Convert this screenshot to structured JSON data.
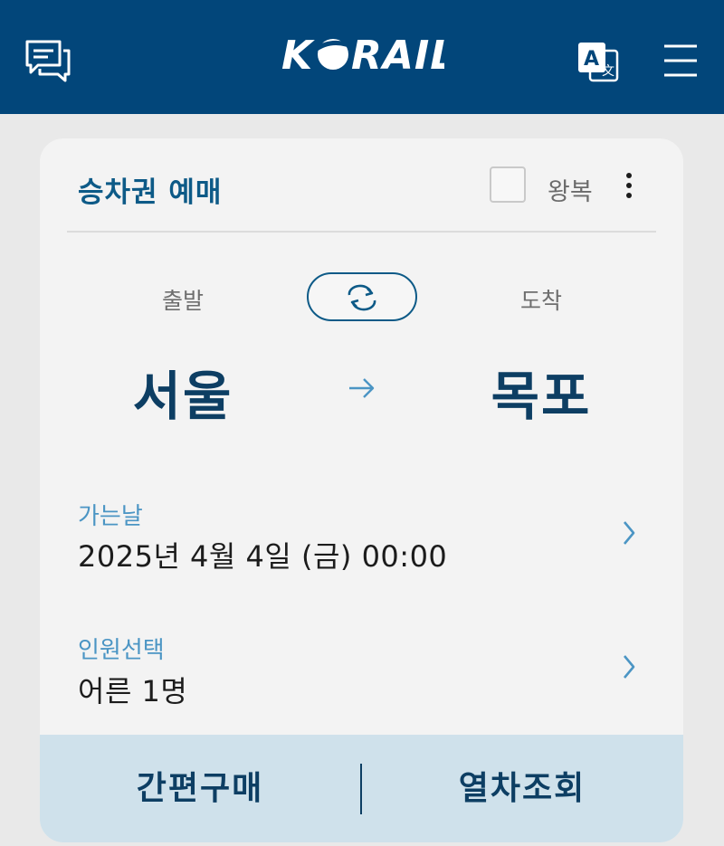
{
  "header": {
    "logo_text": "KORAIL",
    "chat_icon": "chat-icon",
    "translate_icon": "translate-icon",
    "menu_icon": "menu-icon",
    "colors": {
      "bar": "#02467a",
      "icon": "#ffffff"
    }
  },
  "booking": {
    "title": "승차권 예매",
    "round_trip_label": "왕복",
    "round_trip_checked": false,
    "departure_label": "출발",
    "arrival_label": "도착",
    "departure_station": "서울",
    "arrival_station": "목포",
    "swap_icon": "swap-icon",
    "route_arrow_icon": "arrow-right-icon",
    "date": {
      "label": "가는날",
      "value": "2025년 4월 4일 (금) 00:00"
    },
    "passengers": {
      "label": "인원선택",
      "value": "어른 1명"
    }
  },
  "actions": {
    "quick_purchase": "간편구매",
    "train_search": "열차조회"
  },
  "colors": {
    "accent": "#0d5a87",
    "station_text": "#0d3e63",
    "field_label": "#4b95c4",
    "bottom_bar": "#cfe1eb"
  }
}
